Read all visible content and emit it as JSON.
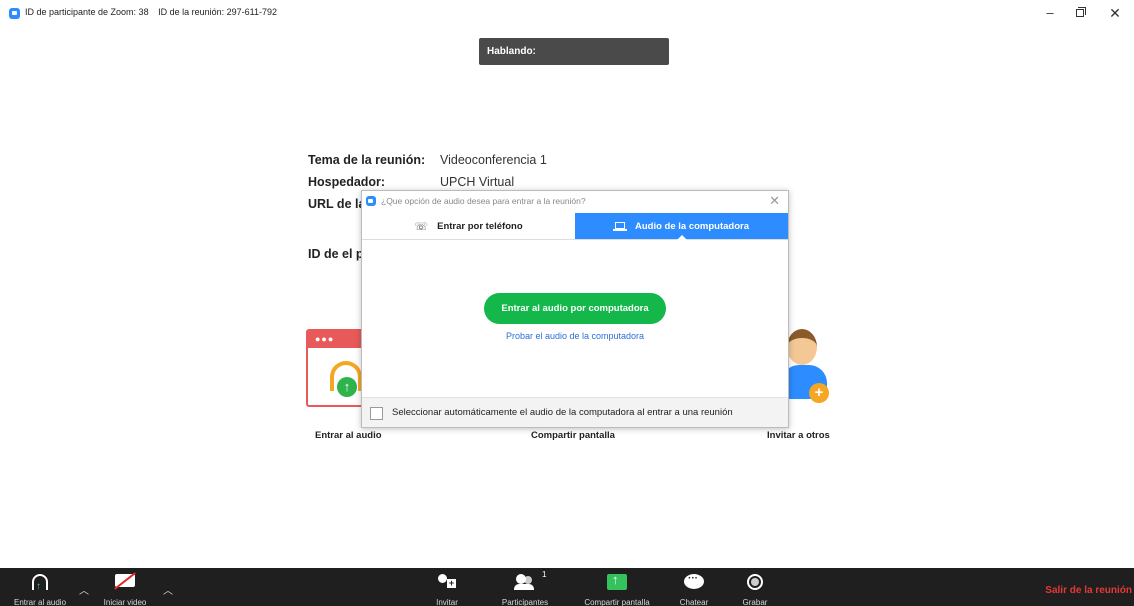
{
  "window": {
    "participant_id": "ID de participante de Zoom: 38",
    "meeting_id": "ID de la reunión: 297-611-792",
    "minimize": "–",
    "close": "✕"
  },
  "speaking": {
    "label": "Hablando:"
  },
  "meeting_info": {
    "topic_label": "Tema de la reunión:",
    "topic_value": "Videoconferencia 1",
    "host_label": "Hospedador:",
    "host_value": "UPCH Virtual",
    "url_label": "URL de la invitación:",
    "participant_id_label": "ID de el participante:"
  },
  "options": {
    "join_audio": "Entrar al audio",
    "share_screen": "Compartir pantalla",
    "invite_others": "Invitar a otros"
  },
  "audio_dialog": {
    "title": "¿Que opción de audio desea para entrar a la reunión?",
    "close": "✕",
    "tabs": [
      {
        "label": "Entrar por teléfono",
        "icon": "phone-icon",
        "active": false
      },
      {
        "label": "Audio de la computadora",
        "icon": "laptop-icon",
        "active": true
      }
    ],
    "join_button": "Entrar al audio por computadora",
    "test_link": "Probar el audio de la computadora",
    "auto_select_label": "Seleccionar automáticamente el audio de la computadora al entrar a una reunión",
    "auto_select_checked": false
  },
  "toolbar": {
    "join_audio": "Entrar al audio",
    "start_video": "Iniciar video",
    "invite": "Invitar",
    "participants": "Participantes",
    "participants_count": "1",
    "share_screen": "Compartir pantalla",
    "chat": "Chatear",
    "record": "Grabar",
    "leave": "Salir de la reunión"
  },
  "colors": {
    "accent": "#2d8cff",
    "join_green": "#14b84a",
    "leave_red": "#e53935",
    "toolbar_bg": "#1f1f1f"
  }
}
